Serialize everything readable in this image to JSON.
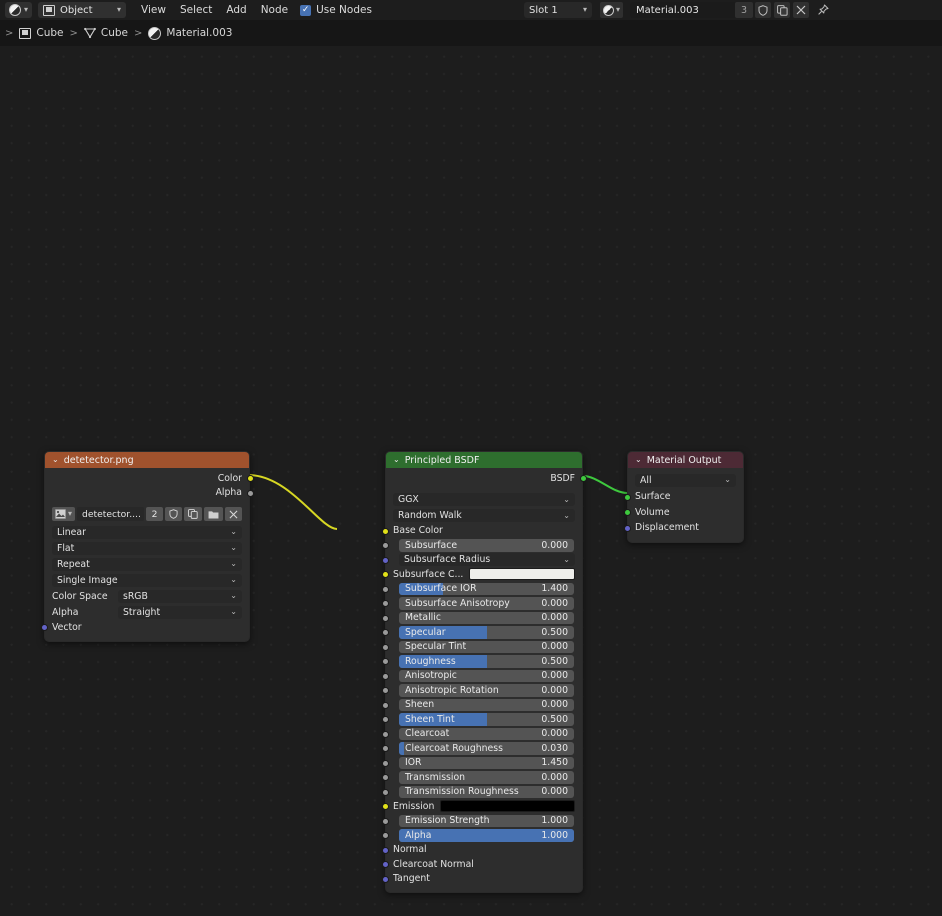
{
  "topbar": {
    "editor_icon": "shader-editor-icon",
    "mode_icon": "object-icon",
    "mode_label": "Object",
    "menus": [
      "View",
      "Select",
      "Add",
      "Node"
    ],
    "use_nodes_label": "Use Nodes",
    "use_nodes_checked": true,
    "slot_label": "Slot 1",
    "material_icon": "material-sphere-icon",
    "material_name": "Material.003",
    "material_users": "3",
    "fake_user_icon": "shield-icon",
    "new_material_icon": "copy-icon",
    "unlink_icon": "close-icon",
    "pin_icon": "pin-icon"
  },
  "breadcrumb": {
    "items": [
      {
        "icon": "object-icon",
        "label": "Cube"
      },
      {
        "icon": "mesh-data-icon",
        "label": "Cube"
      },
      {
        "icon": "material-sphere-icon",
        "label": "Material.003"
      }
    ],
    "separator": ">"
  },
  "colors": {
    "background": "#1d1d1d",
    "image_node_header": "#a0522d",
    "bsdf_node_header": "#2e6e2e",
    "output_node_header": "#4d2a35",
    "node_body": "#2d2d2d",
    "slider_fill": "#4772b3",
    "widget_bg": "#545454",
    "wire_color_link": "#d7d723",
    "wire_shader_link": "#3ec93e",
    "socket_color": "#e0e019",
    "socket_shader": "#3ec93e",
    "socket_vector": "#6363c7",
    "socket_value": "#9a9a9a"
  },
  "nodes": {
    "image_texture": {
      "title": "detetector.png",
      "outputs": [
        {
          "name": "Color",
          "socket": "color"
        },
        {
          "name": "Alpha",
          "socket": "value"
        }
      ],
      "file_row": {
        "browse_icon": "image-browse-icon",
        "name": "detetector....",
        "users": "2",
        "fake_user_icon": "shield-icon",
        "new_icon": "copy-icon",
        "open_icon": "folder-icon",
        "unlink_icon": "close-icon"
      },
      "dropdowns": [
        "Linear",
        "Flat",
        "Repeat",
        "Single Image"
      ],
      "pairs": [
        {
          "label": "Color Space",
          "value": "sRGB"
        },
        {
          "label": "Alpha",
          "value": "Straight"
        }
      ],
      "inputs": [
        {
          "name": "Vector",
          "socket": "vector"
        }
      ]
    },
    "principled_bsdf": {
      "title": "Principled BSDF",
      "outputs": [
        {
          "name": "BSDF",
          "socket": "shader"
        }
      ],
      "dropdowns": [
        "GGX",
        "Random Walk"
      ],
      "inputs": [
        {
          "type": "label",
          "name": "Base Color",
          "socket": "color"
        },
        {
          "type": "slider",
          "name": "Subsurface",
          "socket": "value",
          "value": "0.000",
          "fill": 0
        },
        {
          "type": "dropdown",
          "name": "Subsurface Radius",
          "socket": "vector"
        },
        {
          "type": "color",
          "name": "Subsurface C...",
          "socket": "color",
          "swatch": "#eeeeea"
        },
        {
          "type": "slider",
          "name": "Subsurface IOR",
          "socket": "value",
          "value": "1.400",
          "fill": 25
        },
        {
          "type": "slider",
          "name": "Subsurface Anisotropy",
          "socket": "value",
          "value": "0.000",
          "fill": 0
        },
        {
          "type": "slider",
          "name": "Metallic",
          "socket": "value",
          "value": "0.000",
          "fill": 0
        },
        {
          "type": "slider",
          "name": "Specular",
          "socket": "value",
          "value": "0.500",
          "fill": 50
        },
        {
          "type": "slider",
          "name": "Specular Tint",
          "socket": "value",
          "value": "0.000",
          "fill": 0
        },
        {
          "type": "slider",
          "name": "Roughness",
          "socket": "value",
          "value": "0.500",
          "fill": 50
        },
        {
          "type": "slider",
          "name": "Anisotropic",
          "socket": "value",
          "value": "0.000",
          "fill": 0
        },
        {
          "type": "slider",
          "name": "Anisotropic Rotation",
          "socket": "value",
          "value": "0.000",
          "fill": 0
        },
        {
          "type": "slider",
          "name": "Sheen",
          "socket": "value",
          "value": "0.000",
          "fill": 0
        },
        {
          "type": "slider",
          "name": "Sheen Tint",
          "socket": "value",
          "value": "0.500",
          "fill": 50
        },
        {
          "type": "slider",
          "name": "Clearcoat",
          "socket": "value",
          "value": "0.000",
          "fill": 0
        },
        {
          "type": "slider",
          "name": "Clearcoat Roughness",
          "socket": "value",
          "value": "0.030",
          "fill": 3
        },
        {
          "type": "slider",
          "name": "IOR",
          "socket": "value",
          "value": "1.450",
          "fill": 0
        },
        {
          "type": "slider",
          "name": "Transmission",
          "socket": "value",
          "value": "0.000",
          "fill": 0
        },
        {
          "type": "slider",
          "name": "Transmission Roughness",
          "socket": "value",
          "value": "0.000",
          "fill": 0
        },
        {
          "type": "color",
          "name": "Emission",
          "socket": "color",
          "swatch": "#000000"
        },
        {
          "type": "slider",
          "name": "Emission Strength",
          "socket": "value",
          "value": "1.000",
          "fill": 0
        },
        {
          "type": "slider",
          "name": "Alpha",
          "socket": "value",
          "value": "1.000",
          "fill": 100
        },
        {
          "type": "label",
          "name": "Normal",
          "socket": "vector"
        },
        {
          "type": "label",
          "name": "Clearcoat Normal",
          "socket": "vector"
        },
        {
          "type": "label",
          "name": "Tangent",
          "socket": "vector"
        }
      ]
    },
    "material_output": {
      "title": "Material Output",
      "target": "All",
      "inputs": [
        {
          "name": "Surface",
          "socket": "shader"
        },
        {
          "name": "Volume",
          "socket": "shader"
        },
        {
          "name": "Displacement",
          "socket": "vector"
        }
      ]
    }
  },
  "links": [
    {
      "from": "image_texture.Color",
      "to": "principled_bsdf.Base Color",
      "color": "#d7d723"
    },
    {
      "from": "principled_bsdf.BSDF",
      "to": "material_output.Surface",
      "color": "#3ec93e"
    }
  ]
}
